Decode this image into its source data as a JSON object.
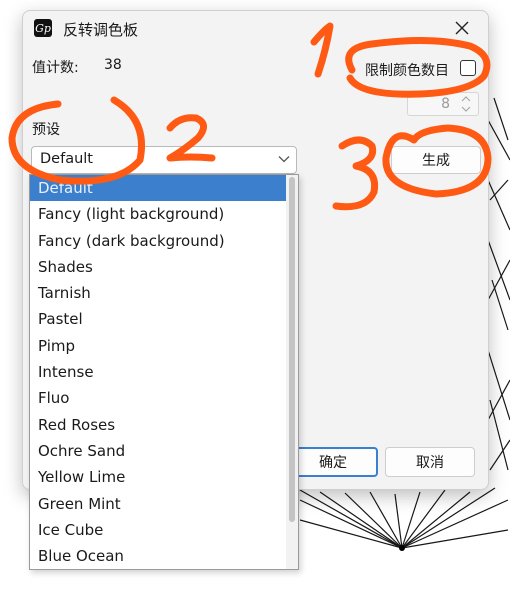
{
  "dialog": {
    "title": "反转调色板",
    "app_icon_text": "Gp",
    "counter_label": "值计数:",
    "counter_value": "38",
    "limit_colors_label": "限制颜色数目",
    "limit_colors_checked": false,
    "color_count_value": "8",
    "preset_label": "预设",
    "preset_selected": "Default",
    "generate_label": "生成",
    "ok_label": "确定",
    "cancel_label": "取消"
  },
  "dropdown": {
    "options": [
      "Default",
      "Fancy (light background)",
      "Fancy (dark background)",
      "Shades",
      "Tarnish",
      "Pastel",
      "Pimp",
      "Intense",
      "Fluo",
      "Red Roses",
      "Ochre Sand",
      "Yellow Lime",
      "Green Mint",
      "Ice Cube",
      "Blue Ocean"
    ],
    "highlighted_index": 0
  },
  "annotations": [
    "1",
    "2",
    "3"
  ],
  "colors": {
    "annotation": "#ff5a14",
    "selection": "#3c7fcd",
    "accent_border": "#3a7fd0"
  }
}
